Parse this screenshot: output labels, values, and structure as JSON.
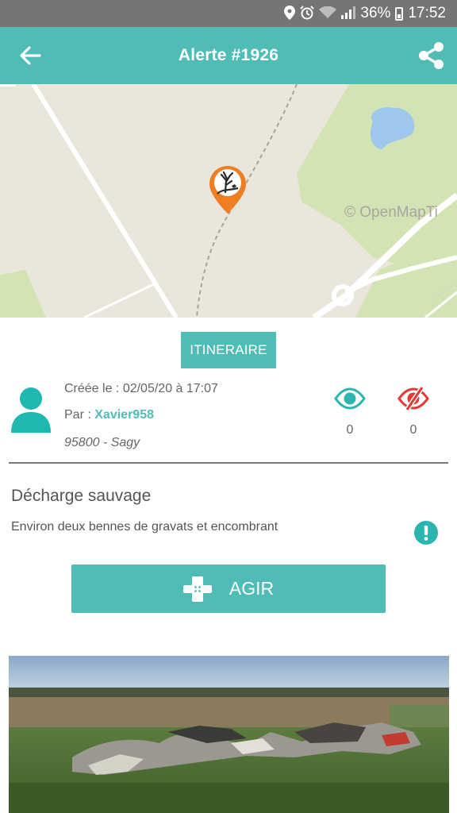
{
  "status_bar": {
    "battery": "36%",
    "time": "17:52",
    "icons": [
      "location-icon",
      "alarm-icon",
      "wifi-icon",
      "signal-icon",
      "battery-icon"
    ]
  },
  "app_bar": {
    "title": "Alerte #1926",
    "back_icon": "arrow-left-icon",
    "share_icon": "share-icon"
  },
  "map": {
    "attribution": "© OpenMapTi",
    "marker_icon": "dead-tree-pollution-icon",
    "colors": {
      "land": "#ebe6dc",
      "forest": "#d3e4b4",
      "water": "#9fc7ec",
      "marker": "#ef7d22"
    }
  },
  "route_button": {
    "label": "ITINERAIRE"
  },
  "alert": {
    "created": "Créée le : 02/05/20 à 17:07",
    "author_prefix": "Par :",
    "author": "Xavier958",
    "location": "95800 - Sagy",
    "seen_count": "0",
    "not_seen_count": "0",
    "category": "Décharge sauvage",
    "description": "Environ deux bennes de gravats et encombrant"
  },
  "act_button": {
    "label": "AGIR",
    "icon": "bandage-plus-icon"
  },
  "colors": {
    "accent": "#4fbdb5",
    "alert_red": "#e53935"
  }
}
